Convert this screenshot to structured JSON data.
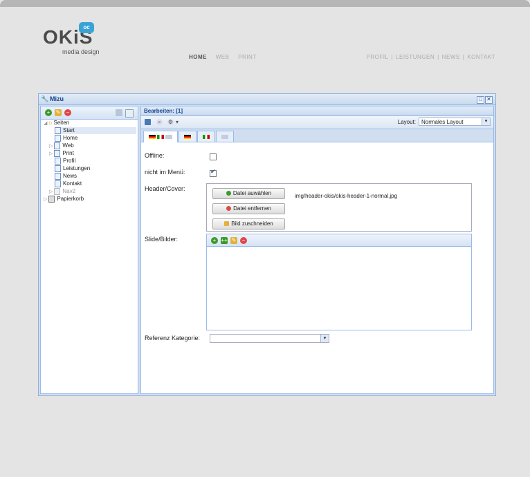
{
  "site": {
    "logo_text": "OKiS",
    "logo_badge": "oc",
    "logo_sub": "media design",
    "nav": [
      "HOME",
      "WEB",
      "PRINT"
    ],
    "right_nav": [
      "PROFIL",
      "LEISTUNGEN",
      "NEWS",
      "KONTAKT"
    ],
    "nav_separator": "|"
  },
  "window": {
    "title": "Mizu"
  },
  "tree": {
    "root": "Seiten",
    "items": [
      "Start",
      "Home",
      "Web",
      "Print",
      "Profil",
      "Leistungen",
      "News",
      "Kontakt",
      "Nav2"
    ],
    "trash": "Papierkorb"
  },
  "editor": {
    "title": "Bearbeiten: [1]",
    "layout_label": "Layout:",
    "layout_value": "Normales Layout",
    "form": {
      "offline_label": "Offline:",
      "offline_checked": false,
      "menu_label": "nicht im Menü:",
      "menu_checked": true,
      "header_label": "Header/Cover:",
      "btn_select": "Datei auwählen",
      "btn_remove": "Datei entfernen",
      "btn_crop": "Bild zuschneiden",
      "image_path": "img/header-okis/okis-header-1-normal.jpg",
      "slides_label": "Slide/Bilder:",
      "category_label": "Referenz Kategorie:",
      "category_value": ""
    }
  },
  "colors": {
    "panel_border": "#99bbe8",
    "title_text": "#15428b",
    "add": "#3a9a2a",
    "remove": "#e04848"
  }
}
